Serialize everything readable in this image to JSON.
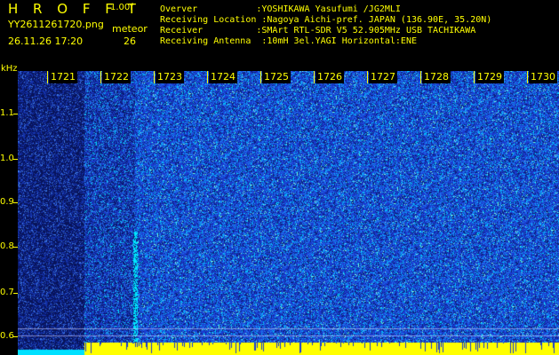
{
  "header": {
    "brand": "H R O F F T",
    "version": "1.00f",
    "filename": "YY2611261720.png",
    "datetime": "26.11.26 17:20",
    "meteor_label": "meteor",
    "meteor_count": "26",
    "observer_row": "Overver           :YOSHIKAWA Yasufumi /JG2MLI",
    "location_row": "Receiving Location :Nagoya Aichi-pref. JAPAN (136.90E, 35.20N)",
    "receiver_row": "Receiver          :SMArt RTL-SDR V5 52.905MHz USB TACHIKAWA",
    "antenna_row": "Receiving Antenna  :10mH 3el.YAGI Horizontal:ENE"
  },
  "axis": {
    "freq_unit": "kHz",
    "freq_ticks": [
      "1.1",
      "1.0",
      "0.9",
      "0.8",
      "0.7",
      "0.6"
    ],
    "time_ticks": [
      "1721",
      "1722",
      "1723",
      "1724",
      "1725",
      "1726",
      "1727",
      "1728",
      "1729",
      "1730"
    ]
  },
  "colors": {
    "label": "#ffff00",
    "background": "#000000",
    "waterfall_dark": "#0a1a5a",
    "waterfall_blue": "#1a3cd0",
    "waterfall_cyan": "#00e0ff",
    "carrier": "#ffff00"
  }
}
